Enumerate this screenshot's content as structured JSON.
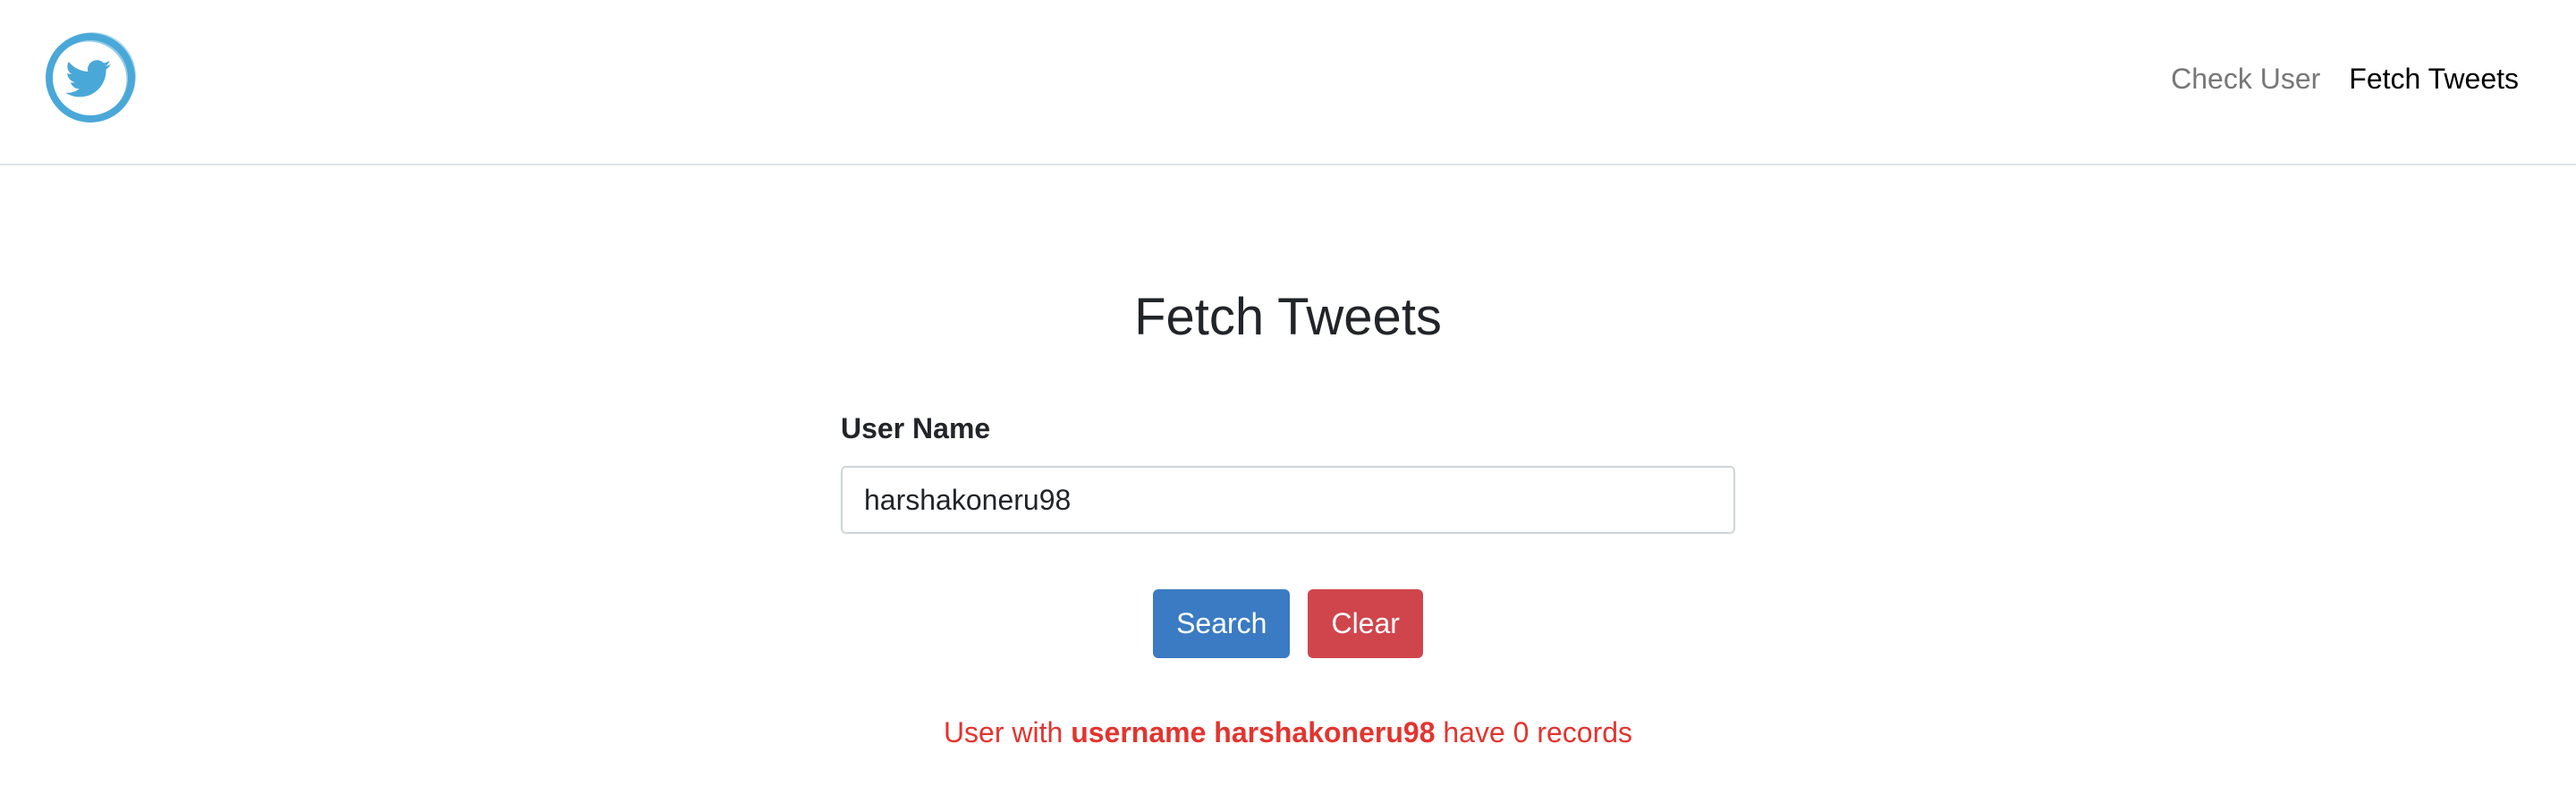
{
  "nav": {
    "logo_icon": "twitter-bird-circle-icon",
    "links": [
      {
        "label": "Check User",
        "active": false
      },
      {
        "label": "Fetch Tweets",
        "active": true
      }
    ]
  },
  "main": {
    "title": "Fetch Tweets",
    "form": {
      "username_label": "User Name",
      "username_value": "harshakoneru98"
    },
    "buttons": {
      "search_label": "Search",
      "clear_label": "Clear"
    },
    "result": {
      "prefix": "User with",
      "bold": "username harshakoneru98",
      "suffix": "have 0 records"
    }
  },
  "colors": {
    "brand": "#4aa8d8",
    "search_button": "#3a7bc3",
    "clear_button": "#d0454c",
    "error_text": "#e3342f"
  }
}
